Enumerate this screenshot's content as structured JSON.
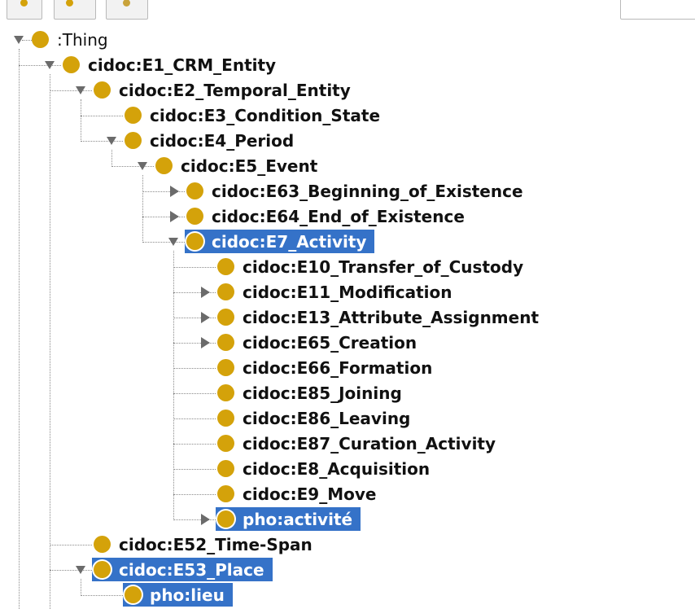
{
  "toolbar": {
    "buttons": [
      {
        "name": "add-subclass-button",
        "icon": "class-add-icon"
      },
      {
        "name": "add-sibling-button",
        "icon": "class-sibling-icon"
      },
      {
        "name": "delete-class-button",
        "icon": "class-delete-icon"
      }
    ]
  },
  "tree": {
    "nodes": [
      {
        "label": ":Thing",
        "depth": 0,
        "toggle": "expanded",
        "selected": false
      },
      {
        "label": "cidoc:E1_CRM_Entity",
        "depth": 1,
        "toggle": "expanded",
        "selected": false
      },
      {
        "label": "cidoc:E2_Temporal_Entity",
        "depth": 2,
        "toggle": "expanded",
        "selected": false
      },
      {
        "label": "cidoc:E3_Condition_State",
        "depth": 3,
        "toggle": "none",
        "selected": false
      },
      {
        "label": "cidoc:E4_Period",
        "depth": 3,
        "toggle": "expanded",
        "selected": false
      },
      {
        "label": "cidoc:E5_Event",
        "depth": 4,
        "toggle": "expanded",
        "selected": false
      },
      {
        "label": "cidoc:E63_Beginning_of_Existence",
        "depth": 5,
        "toggle": "collapsed",
        "selected": false
      },
      {
        "label": "cidoc:E64_End_of_Existence",
        "depth": 5,
        "toggle": "collapsed",
        "selected": false
      },
      {
        "label": "cidoc:E7_Activity",
        "depth": 5,
        "toggle": "expanded",
        "selected": true
      },
      {
        "label": "cidoc:E10_Transfer_of_Custody",
        "depth": 6,
        "toggle": "none",
        "selected": false
      },
      {
        "label": "cidoc:E11_Modification",
        "depth": 6,
        "toggle": "collapsed",
        "selected": false
      },
      {
        "label": "cidoc:E13_Attribute_Assignment",
        "depth": 6,
        "toggle": "collapsed",
        "selected": false
      },
      {
        "label": "cidoc:E65_Creation",
        "depth": 6,
        "toggle": "collapsed",
        "selected": false
      },
      {
        "label": "cidoc:E66_Formation",
        "depth": 6,
        "toggle": "none",
        "selected": false
      },
      {
        "label": "cidoc:E85_Joining",
        "depth": 6,
        "toggle": "none",
        "selected": false
      },
      {
        "label": "cidoc:E86_Leaving",
        "depth": 6,
        "toggle": "none",
        "selected": false
      },
      {
        "label": "cidoc:E87_Curation_Activity",
        "depth": 6,
        "toggle": "none",
        "selected": false
      },
      {
        "label": "cidoc:E8_Acquisition",
        "depth": 6,
        "toggle": "none",
        "selected": false
      },
      {
        "label": "cidoc:E9_Move",
        "depth": 6,
        "toggle": "none",
        "selected": false
      },
      {
        "label": "pho:activité",
        "depth": 6,
        "toggle": "collapsed",
        "selected": true
      },
      {
        "label": "cidoc:E52_Time-Span",
        "depth": 2,
        "toggle": "none",
        "selected": false
      },
      {
        "label": "cidoc:E53_Place",
        "depth": 2,
        "toggle": "expanded",
        "selected": true
      },
      {
        "label": "pho:lieu",
        "depth": 3,
        "toggle": "none",
        "selected": true
      }
    ]
  },
  "colors": {
    "class_icon": "#d4a20a",
    "selection": "#3572c8",
    "toggle": "#6b6b6b"
  }
}
